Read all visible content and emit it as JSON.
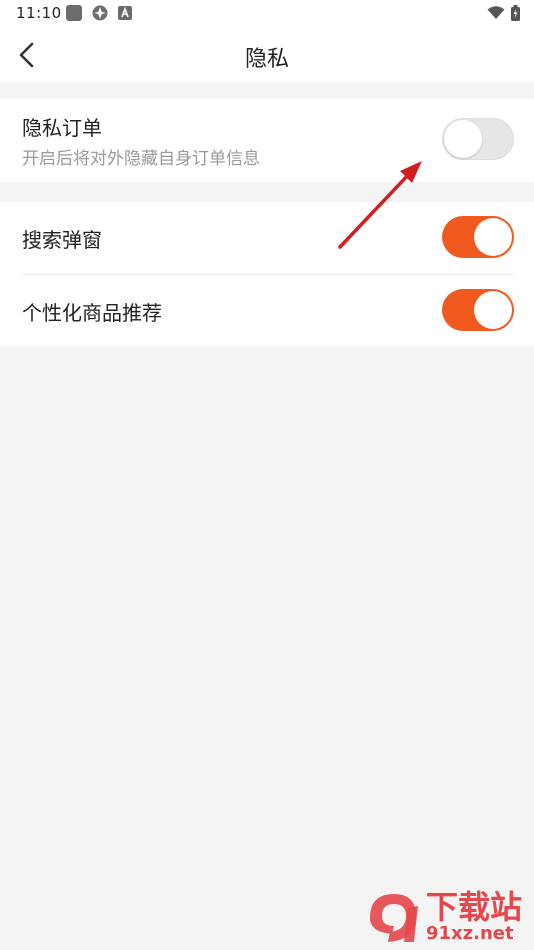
{
  "status_bar": {
    "time": "11:10"
  },
  "header": {
    "title": "隐私"
  },
  "settings": {
    "private_order": {
      "label": "隐私订单",
      "description": "开启后将对外隐藏自身订单信息",
      "enabled": false
    },
    "search_popup": {
      "label": "搜索弹窗",
      "enabled": true
    },
    "personalized_recommend": {
      "label": "个性化商品推荐",
      "enabled": true
    }
  },
  "watermark": {
    "cn": "下载站",
    "url": "91xz.net"
  },
  "colors": {
    "accent": "#f15a1f",
    "toggle_off": "#e6e6e6",
    "background": "#f4f4f4",
    "annotation_arrow": "#d11f1f"
  },
  "icons": [
    "back-arrow-icon",
    "wifi-icon",
    "battery-icon",
    "notification-icon",
    "app-icon"
  ]
}
